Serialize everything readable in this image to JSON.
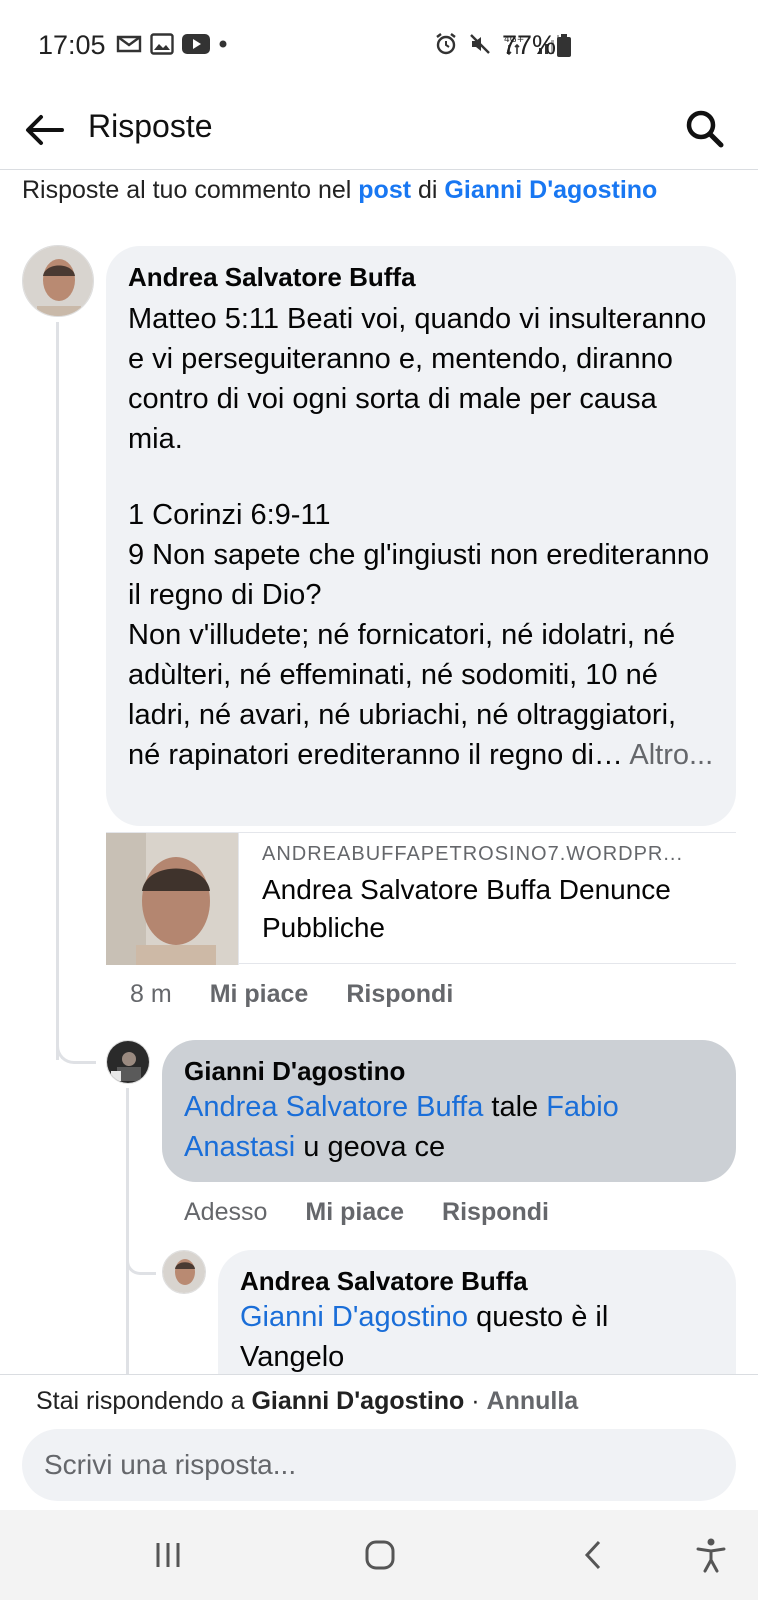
{
  "status_bar": {
    "time": "17:05",
    "battery": "77%",
    "left_icons": [
      "gmail-icon",
      "gallery-icon",
      "youtube-icon",
      "dot-icon"
    ],
    "right_icons": [
      "alarm-icon",
      "mute-icon",
      "4g-icon",
      "signal-icon",
      "battery-icon"
    ]
  },
  "header": {
    "title": "Risposte",
    "back_icon": "back-arrow-icon",
    "search_icon": "search-icon"
  },
  "context": {
    "prefix": "Risposte al tuo commento nel ",
    "post_link": "post",
    "middle": " di ",
    "author_link": "Gianni D'agostino"
  },
  "comments": [
    {
      "author": "Andrea Salvatore Buffa",
      "lines": [
        "Matteo 5:11  Beati voi, quando vi insulteranno e vi perseguiteranno e, mentendo, diranno contro di voi ogni sorta di male per causa mia.",
        "1 Corinzi 6:9-11",
        "9  Non sapete che gl'ingiusti non erediteranno il regno di Dio?",
        "Non v'illudete; né fornicatori, né idolatri, né adùlteri, né effeminati, né sodomiti, 10 né ladri, né avari, né ubriachi, né oltraggiatori, né rapinatori erediteranno il regno di… "
      ],
      "more": "Altro...",
      "link_preview": {
        "domain": "ANDREABUFFAPETROSINO7.WORDPR...",
        "title": "Andrea Salvatore Buffa Denunce Pubbliche"
      },
      "time": "8 m",
      "like": "Mi piace",
      "reply": "Rispondi"
    },
    {
      "author": "Gianni D'agostino",
      "mention1": "Andrea Salvatore Buffa",
      "text1": " tale ",
      "mention2": "Fabio Anastasi",
      "text2": " u geova ce",
      "time": "Adesso",
      "like": "Mi piace",
      "reply": "Rispondi"
    },
    {
      "author": "Andrea Salvatore Buffa",
      "mention1": "Gianni D'agostino",
      "text1": " questo è il Vangelo"
    }
  ],
  "reply_bar": {
    "prefix": "Stai rispondendo a ",
    "name": "Gianni D'agostino",
    "separator": " · ",
    "cancel": "Annulla",
    "placeholder": "Scrivi una risposta..."
  },
  "nav_bar": {
    "buttons": [
      "recent-apps-icon",
      "home-icon",
      "back-icon",
      "accessibility-icon"
    ]
  },
  "colors": {
    "link_blue": "#1877f2",
    "bubble_grey": "#f0f2f5",
    "bubble_highlight": "#ccd0d5",
    "secondary_text": "#65676b"
  }
}
